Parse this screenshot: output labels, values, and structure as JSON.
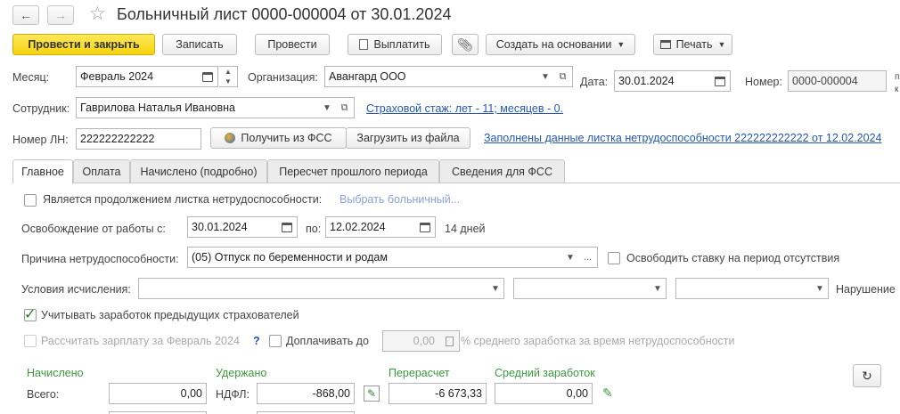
{
  "window": {
    "title": "Больничный лист 0000-000004 от 30.01.2024"
  },
  "toolbar": {
    "post_close": "Провести и закрыть",
    "save": "Записать",
    "post": "Провести",
    "pay": "Выплатить",
    "create_based": "Создать на основании",
    "print": "Печать"
  },
  "header": {
    "month_label": "Месяц:",
    "month_value": "Февраль 2024",
    "org_label": "Организация:",
    "org_value": "Авангард ООО",
    "date_label": "Дата:",
    "date_value": "30.01.2024",
    "number_label": "Номер:",
    "number_value": "0000-000004",
    "number_side_1": "п",
    "number_side_2": "к",
    "employee_label": "Сотрудник:",
    "employee_value": "Гаврилова Наталья Ивановна",
    "insurance_link": "Страховой стаж: лет - 11; месяцев - 0.",
    "ln_label": "Номер ЛН:",
    "ln_value": "222222222222",
    "get_fss": "Получить из ФСС",
    "load_file": "Загрузить из файла",
    "filled_link": "Заполнены данные листка нетрудоспособности 222222222222 от 12.02.2024"
  },
  "tabs": [
    {
      "label": "Главное"
    },
    {
      "label": "Оплата"
    },
    {
      "label": "Начислено (подробно)"
    },
    {
      "label": "Пересчет прошлого периода"
    },
    {
      "label": "Сведения для ФСС"
    }
  ],
  "main": {
    "continuation_label": "Является продолжением листка нетрудоспособности:",
    "choose_link": "Выбрать больничный...",
    "release_label": "Освобождение от работы с:",
    "release_from": "30.01.2024",
    "release_to_label": "по:",
    "release_to": "12.02.2024",
    "days": "14 дней",
    "reason_label": "Причина нетрудоспособности:",
    "reason_value": "(05) Отпуск по беременности и родам",
    "free_rate_label": "Освободить ставку на период отсутствия",
    "conditions_label": "Условия исчисления:",
    "violation_label": "Нарушение",
    "prev_earnings_label": "Учитывать заработок предыдущих страхователей",
    "calc_salary_label": "Рассчитать зарплату за Февраль 2024",
    "help_mark": "?",
    "extra_pay_label": "Доплачивать до",
    "extra_pay_value": "0,00",
    "extra_pay_suffix": "% среднего заработка за время нетрудоспособности"
  },
  "totals": {
    "accrued_label": "Начислено",
    "withheld_label": "Удержано",
    "recalc_label": "Перерасчет",
    "avg_label": "Средний заработок",
    "total_label": "Всего:",
    "total_value": "0,00",
    "ndfl_label": "НДФЛ:",
    "ndfl_value": "-868,00",
    "recalc_value": "-6 673,33",
    "avg_value": "0,00"
  },
  "colors": {
    "primary_button": "#f5d20c",
    "link": "#2457b5",
    "section_green": "#3d9a3d"
  }
}
